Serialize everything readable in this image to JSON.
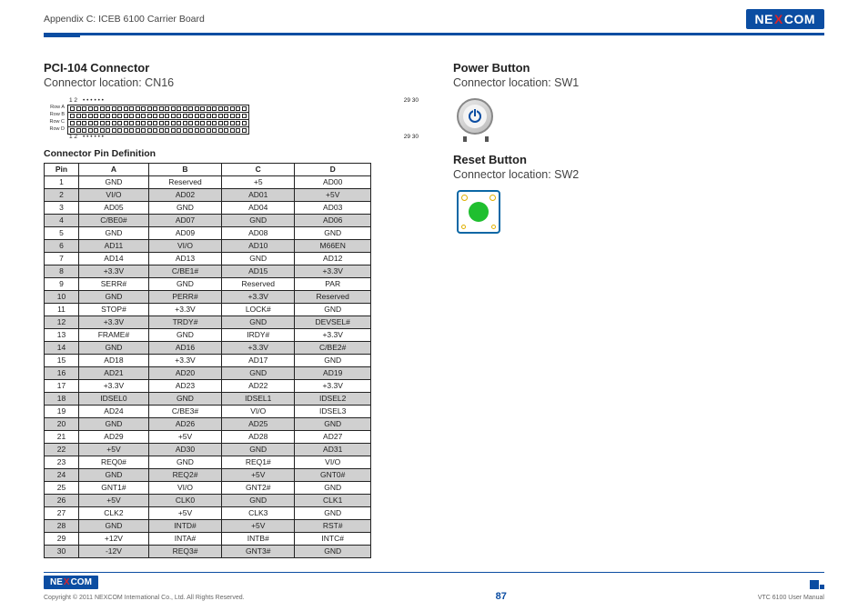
{
  "header": {
    "appendix_title": "Appendix C: ICEB 6100 Carrier Board",
    "logo_text": {
      "pre": "NE",
      "x": "X",
      "post": "COM"
    }
  },
  "left": {
    "title": "PCI-104 Connector",
    "location": "Connector location: CN16",
    "diagram": {
      "num_left": "1   2",
      "num_dots": "• • •",
      "num_right": "29 30",
      "rows": [
        "Row A",
        "Row B",
        "Row C",
        "Row D"
      ]
    },
    "pin_def_title": "Connector Pin Definition",
    "table": {
      "headers": [
        "Pin",
        "A",
        "B",
        "C",
        "D"
      ],
      "rows": [
        [
          "1",
          "GND",
          "Reserved",
          "+5",
          "AD00"
        ],
        [
          "2",
          "VI/O",
          "AD02",
          "AD01",
          "+5V"
        ],
        [
          "3",
          "AD05",
          "GND",
          "AD04",
          "AD03"
        ],
        [
          "4",
          "C/BE0#",
          "AD07",
          "GND",
          "AD06"
        ],
        [
          "5",
          "GND",
          "AD09",
          "AD08",
          "GND"
        ],
        [
          "6",
          "AD11",
          "VI/O",
          "AD10",
          "M66EN"
        ],
        [
          "7",
          "AD14",
          "AD13",
          "GND",
          "AD12"
        ],
        [
          "8",
          "+3.3V",
          "C/BE1#",
          "AD15",
          "+3.3V"
        ],
        [
          "9",
          "SERR#",
          "GND",
          "Reserved",
          "PAR"
        ],
        [
          "10",
          "GND",
          "PERR#",
          "+3.3V",
          "Reserved"
        ],
        [
          "11",
          "STOP#",
          "+3.3V",
          "LOCK#",
          "GND"
        ],
        [
          "12",
          "+3.3V",
          "TRDY#",
          "GND",
          "DEVSEL#"
        ],
        [
          "13",
          "FRAME#",
          "GND",
          "IRDY#",
          "+3.3V"
        ],
        [
          "14",
          "GND",
          "AD16",
          "+3.3V",
          "C/BE2#"
        ],
        [
          "15",
          "AD18",
          "+3.3V",
          "AD17",
          "GND"
        ],
        [
          "16",
          "AD21",
          "AD20",
          "GND",
          "AD19"
        ],
        [
          "17",
          "+3.3V",
          "AD23",
          "AD22",
          "+3.3V"
        ],
        [
          "18",
          "IDSEL0",
          "GND",
          "IDSEL1",
          "IDSEL2"
        ],
        [
          "19",
          "AD24",
          "C/BE3#",
          "VI/O",
          "IDSEL3"
        ],
        [
          "20",
          "GND",
          "AD26",
          "AD25",
          "GND"
        ],
        [
          "21",
          "AD29",
          "+5V",
          "AD28",
          "AD27"
        ],
        [
          "22",
          "+5V",
          "AD30",
          "GND",
          "AD31"
        ],
        [
          "23",
          "REQ0#",
          "GND",
          "REQ1#",
          "VI/O"
        ],
        [
          "24",
          "GND",
          "REQ2#",
          "+5V",
          "GNT0#"
        ],
        [
          "25",
          "GNT1#",
          "VI/O",
          "GNT2#",
          "GND"
        ],
        [
          "26",
          "+5V",
          "CLK0",
          "GND",
          "CLK1"
        ],
        [
          "27",
          "CLK2",
          "+5V",
          "CLK3",
          "GND"
        ],
        [
          "28",
          "GND",
          "INTD#",
          "+5V",
          "RST#"
        ],
        [
          "29",
          "+12V",
          "INTA#",
          "INTB#",
          "INTC#"
        ],
        [
          "30",
          "-12V",
          "REQ3#",
          "GNT3#",
          "GND"
        ]
      ]
    }
  },
  "right": {
    "power_title": "Power Button",
    "power_loc": "Connector location: SW1",
    "reset_title": "Reset Button",
    "reset_loc": "Connector location: SW2"
  },
  "footer": {
    "logo_text": {
      "pre": "NE",
      "x": "X",
      "post": "COM"
    },
    "copyright": "Copyright © 2011 NEXCOM International Co., Ltd. All Rights Reserved.",
    "page": "87",
    "manual": "VTC 6100 User Manual"
  }
}
